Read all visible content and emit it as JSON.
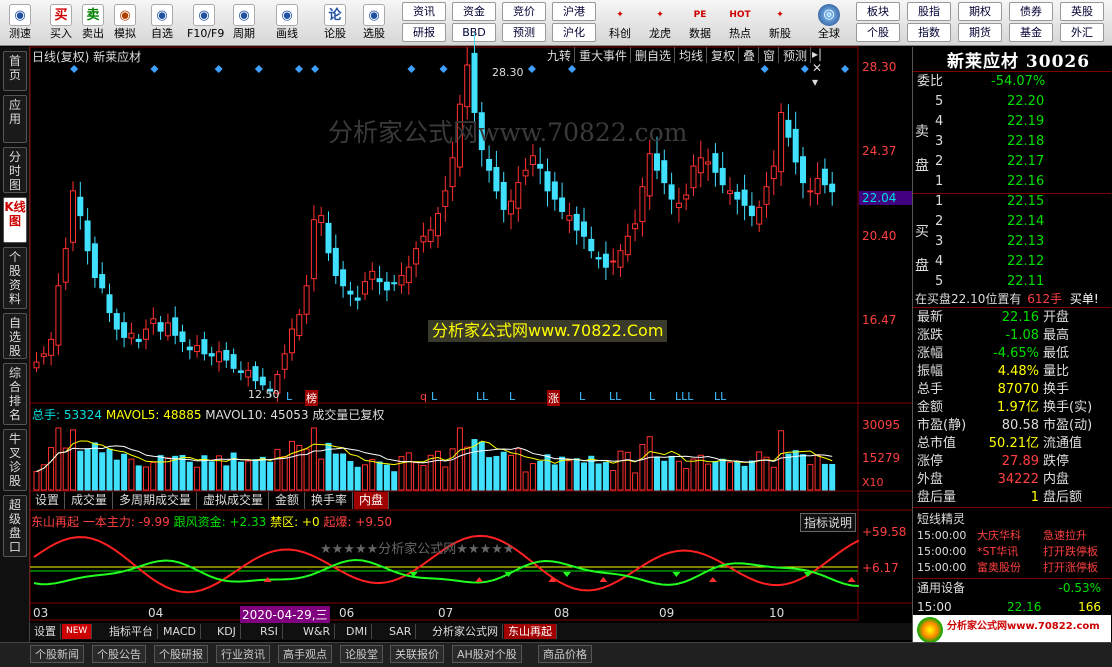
{
  "toolbar": {
    "items": [
      {
        "label": "测速",
        "icon": "clock-icon",
        "color": "#2050a0"
      },
      {
        "label": "买入",
        "icon": "买",
        "color": "#d00000"
      },
      {
        "label": "卖出",
        "icon": "卖",
        "color": "#008000"
      },
      {
        "label": "模拟",
        "icon": "hammer-icon",
        "color": "#b04000"
      },
      {
        "label": "自选",
        "icon": "star-icon",
        "color": "#2050a0"
      },
      {
        "label": "F10/F9",
        "icon": "doc-icon",
        "color": "#2050a0"
      },
      {
        "label": "周期",
        "icon": "cycle-icon",
        "color": "#2050a0"
      },
      {
        "label": "画线",
        "icon": "pen-icon",
        "color": "#2050a0"
      },
      {
        "label": "论股",
        "icon": "论",
        "color": "#2050a0"
      },
      {
        "label": "选股",
        "icon": "pick-icon",
        "color": "#2050a0"
      }
    ],
    "grid1": [
      "资讯",
      "资金",
      "竞价",
      "沪港"
    ],
    "grid2": [
      "研报",
      "BBD",
      "预测",
      "沪化"
    ],
    "items2": [
      {
        "label": "科创",
        "icon": "rocket-icon"
      },
      {
        "label": "龙虎",
        "icon": "dragon-icon"
      },
      {
        "label": "数据",
        "icon": "PE"
      },
      {
        "label": "热点",
        "icon": "HOT"
      },
      {
        "label": "新股",
        "icon": "new-icon"
      }
    ],
    "globe": "全球",
    "grid3": [
      "板块",
      "股指",
      "期权",
      "债券",
      "英股"
    ],
    "grid4": [
      "个股",
      "指数",
      "期货",
      "基金",
      "外汇"
    ]
  },
  "leftnav": [
    "首页",
    "应用",
    "分时图",
    "K线图",
    "个股资料",
    "自选股",
    "综合排名",
    "牛叉诊股",
    "超级盘口"
  ],
  "chart_header": {
    "title": "日线(复权) 新莱应材",
    "tabs": [
      "九转",
      "重大事件",
      "删自选",
      "均线",
      "复权",
      "叠",
      "窗",
      "预测"
    ]
  },
  "watermark1": "分析家公式网www.70822.com",
  "watermark2": "分析家公式网www.70822.Com",
  "watermark3": "★★★★★分析家公式网★★★★★",
  "price_axis": [
    "28.30",
    "24.37",
    "22.04",
    "20.40",
    "16.47"
  ],
  "high_label": "28.30",
  "low_label": "12.50",
  "signals": [
    "L",
    "榜",
    "q",
    "L",
    "LL",
    "L",
    "涨",
    "L",
    "LL",
    "L",
    "LLL",
    "LL"
  ],
  "volume": {
    "label": "总手: 53324",
    "mavol5": "MAVOL5: 48885",
    "mavol10": "MAVOL10: 45053",
    "note": "成交量已复权",
    "axis": [
      "30095",
      "15279",
      "X10"
    ]
  },
  "vol_tabs": [
    "设置",
    "成交量",
    "多周期成交量",
    "虚拟成交量",
    "金额",
    "换手率",
    "内盘"
  ],
  "indicator": {
    "name": "东山再起",
    "f1": "一本主力: -9.99",
    "f2": "跟风资金: +2.33",
    "f3": "禁区: +0",
    "f4": "起爆: +9.50",
    "help": "指标说明",
    "axis": [
      "+59.58",
      "+6.17"
    ]
  },
  "dates": [
    "03",
    "04",
    "2020-04-29,三",
    "06",
    "07",
    "08",
    "09",
    "10"
  ],
  "bottom_tabs": [
    "设置",
    "NEW",
    "指标平台",
    "MACD",
    "KDJ",
    "RSI",
    "W&R",
    "DMI",
    "SAR",
    "分析家公式网",
    "东山再起"
  ],
  "status_tabs": [
    "个股新闻",
    "个股公告",
    "个股研报",
    "行业资讯",
    "高手观点",
    "论股堂",
    "关联报价",
    "AH股对个股",
    "商品价格"
  ],
  "right_panel": {
    "title": "新莱应材 30026",
    "weibi": {
      "label": "委比",
      "value": "-54.07%"
    },
    "sell_side": "卖盘",
    "buy_side": "买盘",
    "asks": [
      {
        "n": "5",
        "p": "22.20"
      },
      {
        "n": "4",
        "p": "22.19"
      },
      {
        "n": "3",
        "p": "22.18"
      },
      {
        "n": "2",
        "p": "22.17"
      },
      {
        "n": "1",
        "p": "22.16"
      }
    ],
    "bids": [
      {
        "n": "1",
        "p": "22.15"
      },
      {
        "n": "2",
        "p": "22.14"
      },
      {
        "n": "3",
        "p": "22.13"
      },
      {
        "n": "4",
        "p": "22.12"
      },
      {
        "n": "5",
        "p": "22.11"
      }
    ],
    "note": "在买盘22.10位置有",
    "note_vol": "612手",
    "note_btn": "买单!",
    "stats": [
      {
        "a": "最新",
        "b": "22.16",
        "bc": "grn",
        "c": "开盘"
      },
      {
        "a": "涨跌",
        "b": "-1.08",
        "bc": "grn",
        "c": "最高"
      },
      {
        "a": "涨幅",
        "b": "-4.65%",
        "bc": "grn",
        "c": "最低"
      },
      {
        "a": "振幅",
        "b": "4.48%",
        "bc": "yel",
        "c": "量比"
      },
      {
        "a": "总手",
        "b": "87070",
        "bc": "yel",
        "c": "换手"
      },
      {
        "a": "金额",
        "b": "1.97亿",
        "bc": "yel",
        "c": "换手(实)"
      },
      {
        "a": "市盈(静)",
        "b": "80.58",
        "bc": "wht",
        "c": "市盈(动)"
      },
      {
        "a": "总市值",
        "b": "50.21亿",
        "bc": "yel",
        "c": "流通值"
      },
      {
        "a": "涨停",
        "b": "27.89",
        "bc": "red",
        "c": "跌停"
      },
      {
        "a": "外盘",
        "b": "34222",
        "bc": "red",
        "c": "内盘"
      },
      {
        "a": "盘后量",
        "b": "1",
        "bc": "yel",
        "c": "盘后额"
      }
    ],
    "sprite_title": "短线精灵",
    "sprites": [
      {
        "t": "15:00:00",
        "s": "大庆华科",
        "e": "急速拉升"
      },
      {
        "t": "15:00:00",
        "s": "*ST华讯",
        "e": "打开跌停板"
      },
      {
        "t": "15:00:00",
        "s": "富奥股份",
        "e": "打开涨停板"
      }
    ],
    "tongyong": {
      "label": "通用设备",
      "value": "-0.53%"
    },
    "last": {
      "t": "15:00",
      "p": "22.16",
      "v": "166"
    }
  },
  "colors": {
    "up": "#ff3030",
    "down": "#40e0ff",
    "yellow": "#ffff00",
    "green": "#00e000"
  },
  "chart_data": {
    "type": "candlestick",
    "closes": [
      13.9,
      14.3,
      15.0,
      17.6,
      19.4,
      22.2,
      21.0,
      19.3,
      18.0,
      17.5,
      16.3,
      15.5,
      15.1,
      15.3,
      14.9,
      15.5,
      16.0,
      15.4,
      15.8,
      15.2,
      14.9,
      14.5,
      14.7,
      14.3,
      14.2,
      14.4,
      14.0,
      13.6,
      13.4,
      13.5,
      13.0,
      12.8,
      12.5,
      13.3,
      14.3,
      15.5,
      16.2,
      17.6,
      20.8,
      21.0,
      19.2,
      18.1,
      17.6,
      17.2,
      16.9,
      17.8,
      18.3,
      17.8,
      17.4,
      17.7,
      18.1,
      18.5,
      19.4,
      20.0,
      20.3,
      21.1,
      22.2,
      23.8,
      26.4,
      28.3,
      26.0,
      24.2,
      23.2,
      22.2,
      21.3,
      21.7,
      22.6,
      23.2,
      23.9,
      23.3,
      22.2,
      21.8,
      21.2,
      21.0,
      20.3,
      20.0,
      19.3,
      18.9,
      18.5,
      18.8,
      19.3,
      20.0,
      20.6,
      22.4,
      24.0,
      23.2,
      22.6,
      21.8,
      21.6,
      22.0,
      23.4,
      23.8,
      23.6,
      23.1,
      22.5,
      22.2,
      21.8,
      21.5,
      21.0,
      21.4,
      22.4,
      23.4,
      26.0,
      24.8,
      23.6,
      22.6,
      22.2,
      22.8,
      22.5,
      22.16
    ]
  }
}
